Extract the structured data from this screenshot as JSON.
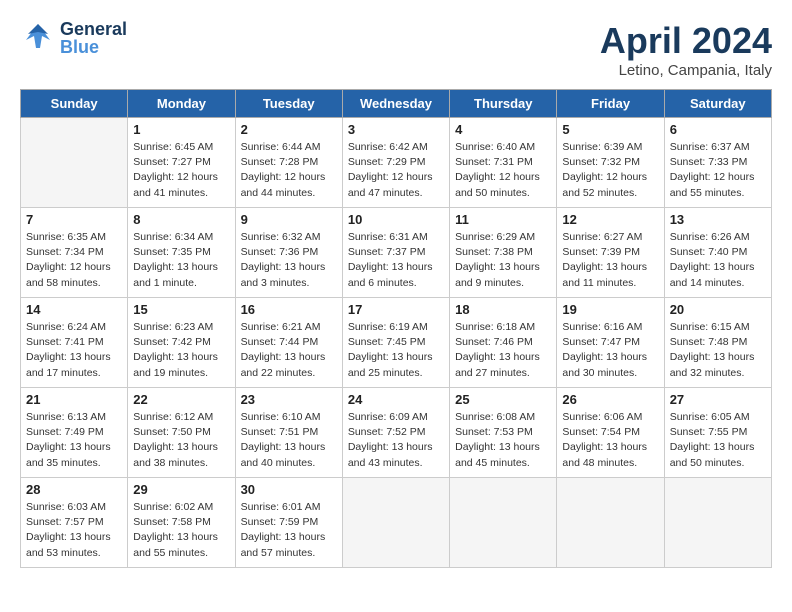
{
  "header": {
    "logo_general": "General",
    "logo_blue": "Blue",
    "month_title": "April 2024",
    "location": "Letino, Campania, Italy"
  },
  "days_of_week": [
    "Sunday",
    "Monday",
    "Tuesday",
    "Wednesday",
    "Thursday",
    "Friday",
    "Saturday"
  ],
  "weeks": [
    [
      {
        "day": "",
        "info": ""
      },
      {
        "day": "1",
        "info": "Sunrise: 6:45 AM\nSunset: 7:27 PM\nDaylight: 12 hours\nand 41 minutes."
      },
      {
        "day": "2",
        "info": "Sunrise: 6:44 AM\nSunset: 7:28 PM\nDaylight: 12 hours\nand 44 minutes."
      },
      {
        "day": "3",
        "info": "Sunrise: 6:42 AM\nSunset: 7:29 PM\nDaylight: 12 hours\nand 47 minutes."
      },
      {
        "day": "4",
        "info": "Sunrise: 6:40 AM\nSunset: 7:31 PM\nDaylight: 12 hours\nand 50 minutes."
      },
      {
        "day": "5",
        "info": "Sunrise: 6:39 AM\nSunset: 7:32 PM\nDaylight: 12 hours\nand 52 minutes."
      },
      {
        "day": "6",
        "info": "Sunrise: 6:37 AM\nSunset: 7:33 PM\nDaylight: 12 hours\nand 55 minutes."
      }
    ],
    [
      {
        "day": "7",
        "info": "Sunrise: 6:35 AM\nSunset: 7:34 PM\nDaylight: 12 hours\nand 58 minutes."
      },
      {
        "day": "8",
        "info": "Sunrise: 6:34 AM\nSunset: 7:35 PM\nDaylight: 13 hours\nand 1 minute."
      },
      {
        "day": "9",
        "info": "Sunrise: 6:32 AM\nSunset: 7:36 PM\nDaylight: 13 hours\nand 3 minutes."
      },
      {
        "day": "10",
        "info": "Sunrise: 6:31 AM\nSunset: 7:37 PM\nDaylight: 13 hours\nand 6 minutes."
      },
      {
        "day": "11",
        "info": "Sunrise: 6:29 AM\nSunset: 7:38 PM\nDaylight: 13 hours\nand 9 minutes."
      },
      {
        "day": "12",
        "info": "Sunrise: 6:27 AM\nSunset: 7:39 PM\nDaylight: 13 hours\nand 11 minutes."
      },
      {
        "day": "13",
        "info": "Sunrise: 6:26 AM\nSunset: 7:40 PM\nDaylight: 13 hours\nand 14 minutes."
      }
    ],
    [
      {
        "day": "14",
        "info": "Sunrise: 6:24 AM\nSunset: 7:41 PM\nDaylight: 13 hours\nand 17 minutes."
      },
      {
        "day": "15",
        "info": "Sunrise: 6:23 AM\nSunset: 7:42 PM\nDaylight: 13 hours\nand 19 minutes."
      },
      {
        "day": "16",
        "info": "Sunrise: 6:21 AM\nSunset: 7:44 PM\nDaylight: 13 hours\nand 22 minutes."
      },
      {
        "day": "17",
        "info": "Sunrise: 6:19 AM\nSunset: 7:45 PM\nDaylight: 13 hours\nand 25 minutes."
      },
      {
        "day": "18",
        "info": "Sunrise: 6:18 AM\nSunset: 7:46 PM\nDaylight: 13 hours\nand 27 minutes."
      },
      {
        "day": "19",
        "info": "Sunrise: 6:16 AM\nSunset: 7:47 PM\nDaylight: 13 hours\nand 30 minutes."
      },
      {
        "day": "20",
        "info": "Sunrise: 6:15 AM\nSunset: 7:48 PM\nDaylight: 13 hours\nand 32 minutes."
      }
    ],
    [
      {
        "day": "21",
        "info": "Sunrise: 6:13 AM\nSunset: 7:49 PM\nDaylight: 13 hours\nand 35 minutes."
      },
      {
        "day": "22",
        "info": "Sunrise: 6:12 AM\nSunset: 7:50 PM\nDaylight: 13 hours\nand 38 minutes."
      },
      {
        "day": "23",
        "info": "Sunrise: 6:10 AM\nSunset: 7:51 PM\nDaylight: 13 hours\nand 40 minutes."
      },
      {
        "day": "24",
        "info": "Sunrise: 6:09 AM\nSunset: 7:52 PM\nDaylight: 13 hours\nand 43 minutes."
      },
      {
        "day": "25",
        "info": "Sunrise: 6:08 AM\nSunset: 7:53 PM\nDaylight: 13 hours\nand 45 minutes."
      },
      {
        "day": "26",
        "info": "Sunrise: 6:06 AM\nSunset: 7:54 PM\nDaylight: 13 hours\nand 48 minutes."
      },
      {
        "day": "27",
        "info": "Sunrise: 6:05 AM\nSunset: 7:55 PM\nDaylight: 13 hours\nand 50 minutes."
      }
    ],
    [
      {
        "day": "28",
        "info": "Sunrise: 6:03 AM\nSunset: 7:57 PM\nDaylight: 13 hours\nand 53 minutes."
      },
      {
        "day": "29",
        "info": "Sunrise: 6:02 AM\nSunset: 7:58 PM\nDaylight: 13 hours\nand 55 minutes."
      },
      {
        "day": "30",
        "info": "Sunrise: 6:01 AM\nSunset: 7:59 PM\nDaylight: 13 hours\nand 57 minutes."
      },
      {
        "day": "",
        "info": ""
      },
      {
        "day": "",
        "info": ""
      },
      {
        "day": "",
        "info": ""
      },
      {
        "day": "",
        "info": ""
      }
    ]
  ]
}
